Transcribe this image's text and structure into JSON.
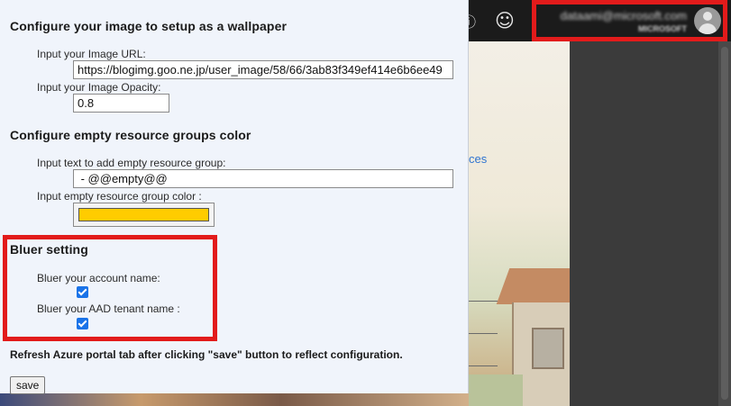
{
  "panel": {
    "wallpaper": {
      "heading": "Configure your image to setup as a wallpaper",
      "url_label": "Input your Image URL:",
      "url_value": "https://blogimg.goo.ne.jp/user_image/58/66/3ab83f349ef414e6b6ee49",
      "opacity_label": "Input your Image Opacity:",
      "opacity_value": "0.8"
    },
    "empty_groups": {
      "heading": "Configure empty resource groups color",
      "text_label": "Input text to add empty resource group:",
      "text_value": " - @@empty@@",
      "color_label": "Input empty resource group color :",
      "color_value": "#ffcc00"
    },
    "bluer": {
      "heading": "Bluer setting",
      "account_label": "Bluer your account name:",
      "account_checked": true,
      "tenant_label": "Bluer your AAD tenant name :",
      "tenant_checked": true
    },
    "note": "Refresh Azure portal tab after clicking \"save\" button to reflect configuration.",
    "save_label": "save"
  },
  "topbar": {
    "smiley_icon": "☺",
    "account_name": "dataami@microsoft.com",
    "account_tenant": "MICROSOFT"
  },
  "background": {
    "link_text": "ces"
  },
  "colors": {
    "highlight": "#e21b1b",
    "panel_bg": "#f0f4fb",
    "topbar_bg": "#1b1b1b"
  }
}
